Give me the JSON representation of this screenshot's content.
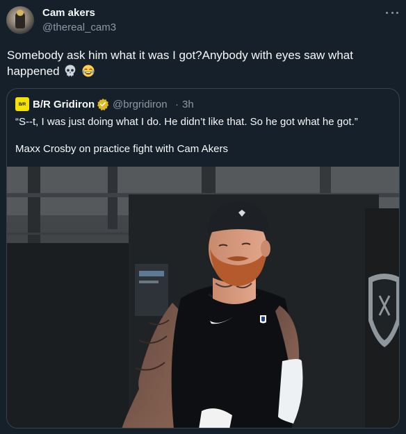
{
  "tweet": {
    "author_name": "Cam akers",
    "author_handle": "@thereal_cam3",
    "text": "Somebody ask him what it was I got?Anybody with eyes saw what happened",
    "emojis": [
      "skull-emoji",
      "tears-of-joy-emoji"
    ],
    "more_icon": "more-horizontal-icon"
  },
  "quoted": {
    "logo_text": "B/R",
    "author_name": "B/R Gridiron",
    "verified_icon": "gold-verified-badge-icon",
    "handle": "@brgridiron",
    "separator": "·",
    "time": "3h",
    "quote_line": "“S--t, I was just doing what I do. He didn’t like that. So he got what he got.”",
    "caption": "Maxx Crosby on practice fight with Cam Akers"
  },
  "colors": {
    "background": "#15202b",
    "primary_text": "#f7f9f9",
    "secondary_text": "#8b98a5",
    "border": "#38444d",
    "verified_gold": "#e2b719"
  }
}
